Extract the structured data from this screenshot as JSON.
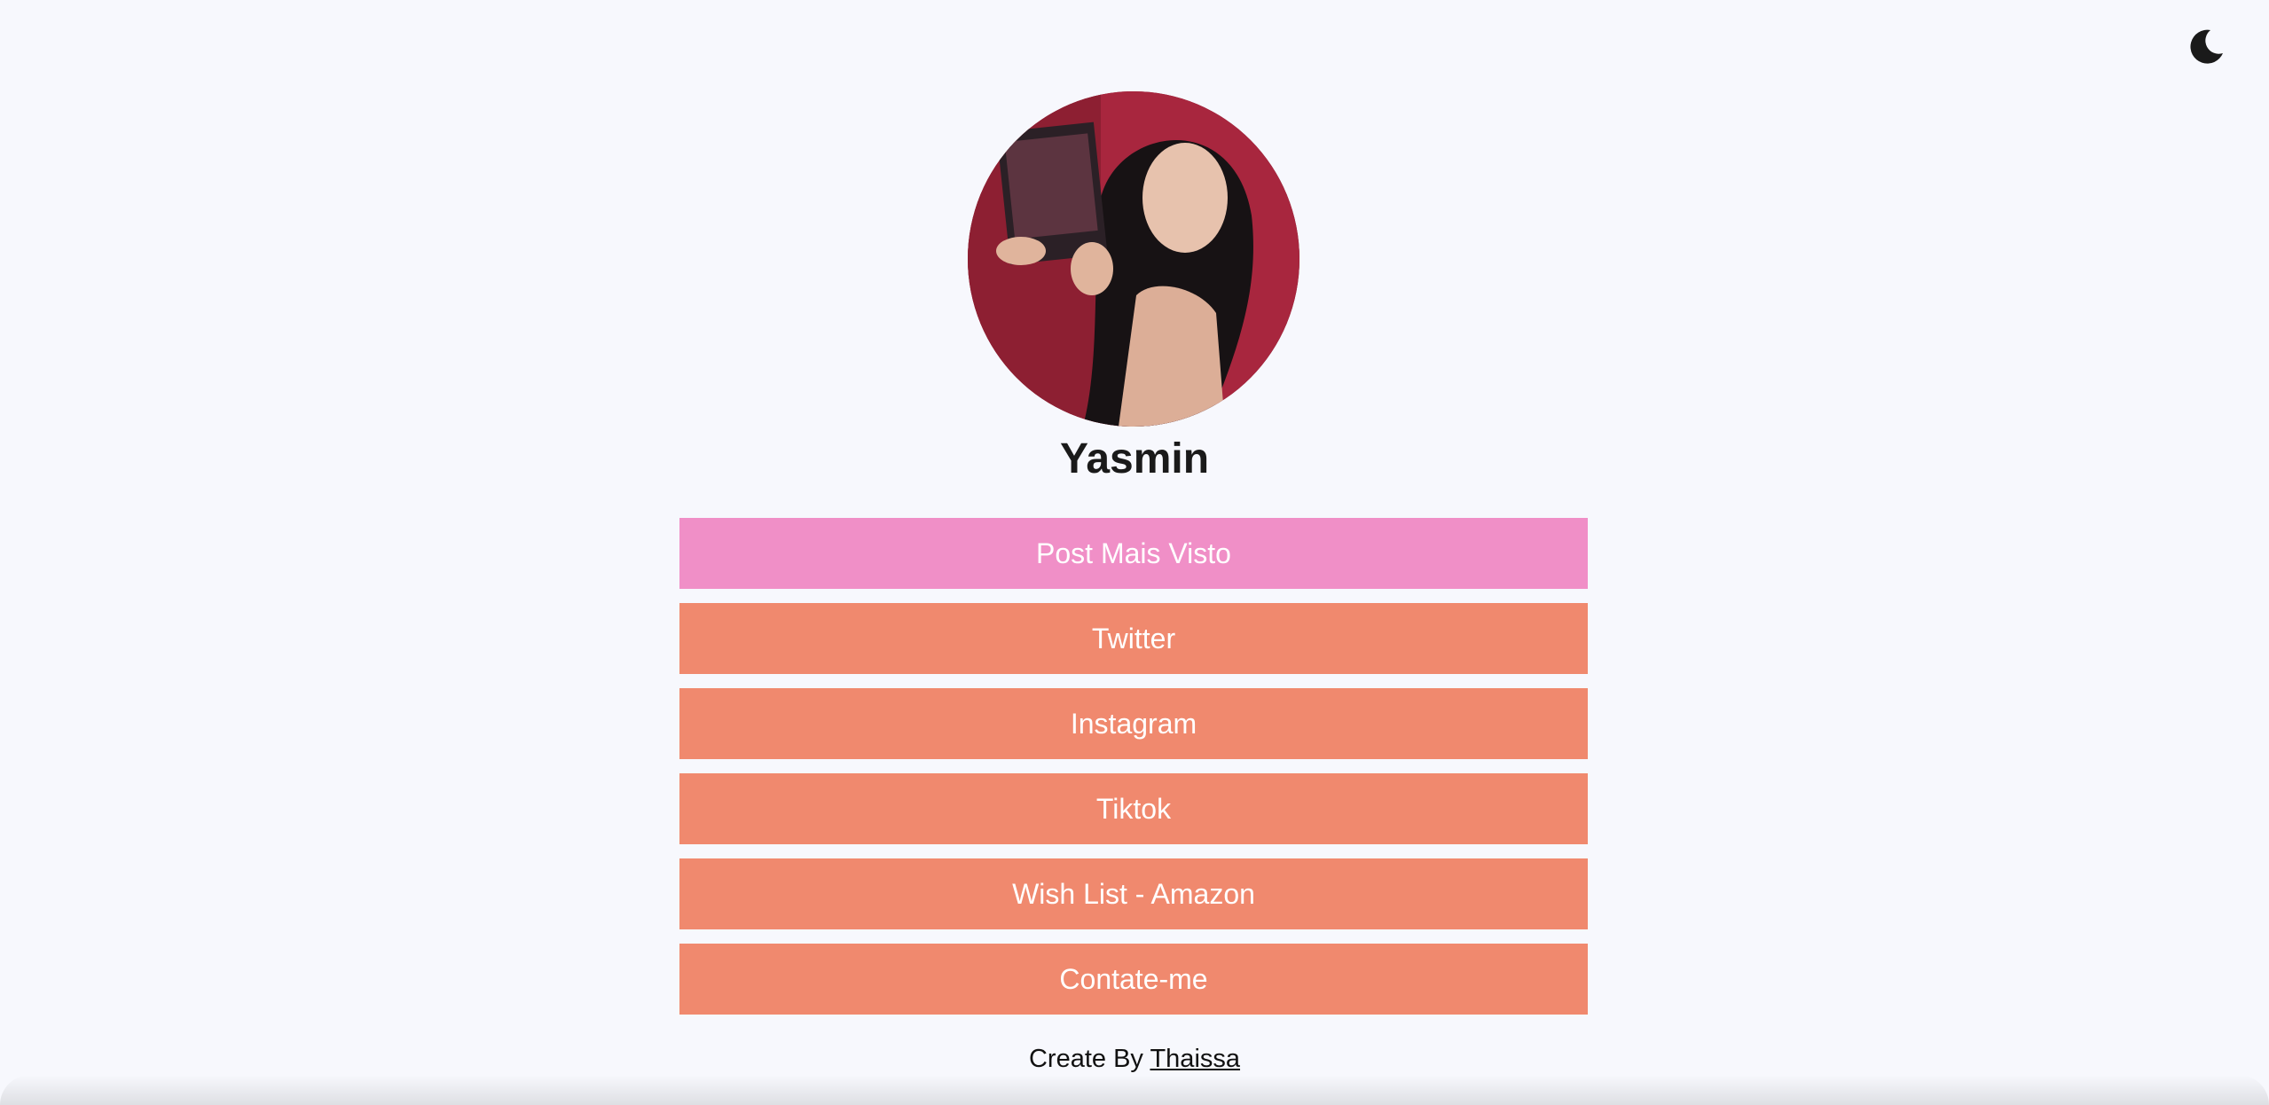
{
  "header": {
    "theme_toggle_icon": "moon-icon"
  },
  "profile": {
    "name": "Yasmin",
    "avatar_icon": "profile-photo"
  },
  "links": [
    {
      "label": "Post Mais Visto",
      "color": "#f08fc7"
    },
    {
      "label": "Twitter",
      "color": "#f0896e"
    },
    {
      "label": "Instagram",
      "color": "#f0896e"
    },
    {
      "label": "Tiktok",
      "color": "#f0896e"
    },
    {
      "label": "Wish List - Amazon",
      "color": "#f0896e"
    },
    {
      "label": "Contate-me",
      "color": "#f0896e"
    }
  ],
  "footer": {
    "prefix": "Create By",
    "author": "Thaissa"
  }
}
